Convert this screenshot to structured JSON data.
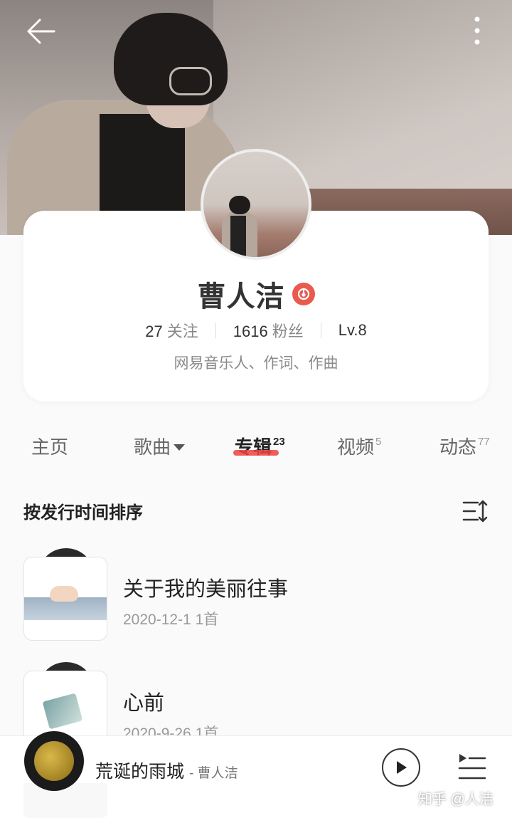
{
  "artist": {
    "name": "曹人洁",
    "follow_count": "27",
    "follow_label": "关注",
    "fans_count": "1616",
    "fans_label": "粉丝",
    "level": "Lv.8",
    "tags": "网易音乐人、作词、作曲"
  },
  "tabs": [
    {
      "label": "主页",
      "count": ""
    },
    {
      "label": "歌曲",
      "count": ""
    },
    {
      "label": "专辑",
      "count": "23"
    },
    {
      "label": "视频",
      "count": "5"
    },
    {
      "label": "动态",
      "count": "77"
    }
  ],
  "active_tab": "专辑",
  "sort": {
    "label": "按发行时间排序"
  },
  "albums": [
    {
      "title": "关于我的美丽往事",
      "meta": "2020-12-1 1首"
    },
    {
      "title": "心前",
      "meta": "2020-9-26 1首"
    }
  ],
  "player": {
    "song": "荒诞的雨城",
    "artist": "- 曹人洁"
  },
  "watermark": "知乎 @人洁",
  "colors": {
    "accent": "#ec4141",
    "badge": "#ea5a4f"
  }
}
